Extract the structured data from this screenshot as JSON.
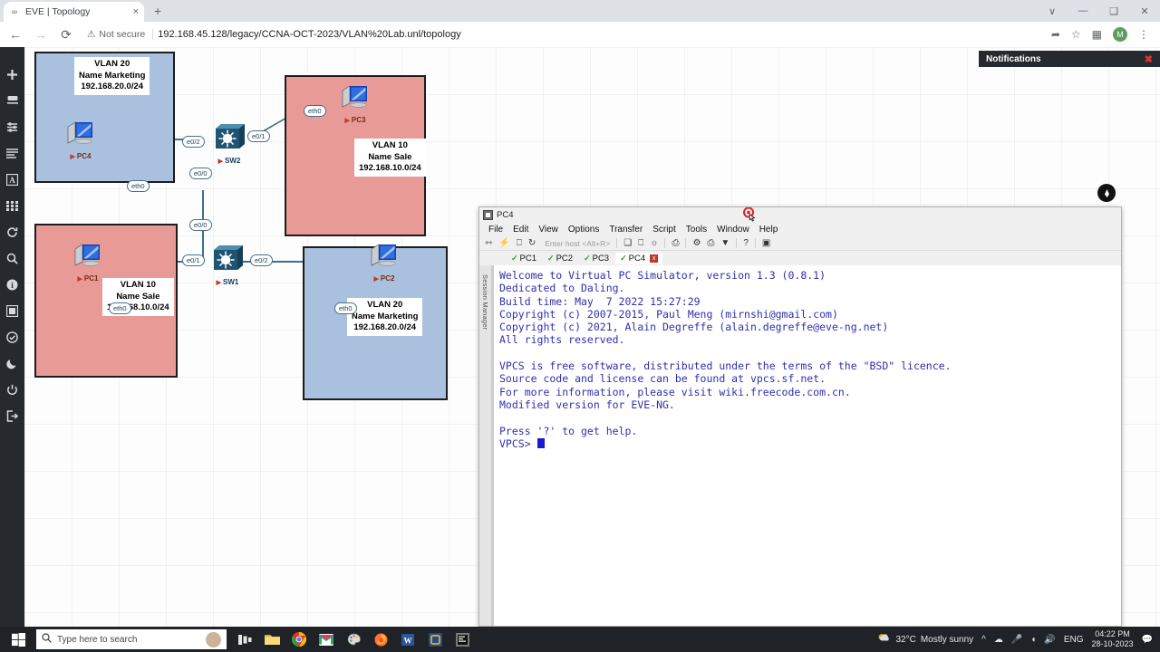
{
  "browser": {
    "tab": {
      "title": "EVE | Topology",
      "favicon": "eve-icon",
      "close": "×"
    },
    "new_tab": "+",
    "window_controls": [
      "∨",
      "—",
      "❑",
      "✕"
    ],
    "nav": {
      "back": "←",
      "forward": "→",
      "reload": "⟳"
    },
    "security_label": "Not secure",
    "url": "192.168.45.128/legacy/CCNA-OCT-2023/VLAN%20Lab.unl/topology",
    "toolbar_right": {
      "share": "share-icon",
      "bookmark": "star-icon",
      "sidepanel": "panel-icon",
      "menu": "⋮"
    },
    "avatar_initial": "M"
  },
  "notifications": {
    "title": "Notifications",
    "close": "✖"
  },
  "eve_sidebar": {
    "items": [
      {
        "name": "add-object-icon",
        "glyph": "+"
      },
      {
        "name": "nodes-icon",
        "glyph": "⌸"
      },
      {
        "name": "network-icon",
        "glyph": "⇅"
      },
      {
        "name": "startup-config-icon",
        "glyph": "≡"
      },
      {
        "name": "text-object-icon",
        "glyph": "A"
      },
      {
        "name": "grid-icon",
        "glyph": "☰"
      },
      {
        "name": "refresh-icon",
        "glyph": "↻"
      },
      {
        "name": "zoom-icon",
        "glyph": "⌕"
      },
      {
        "name": "info-icon",
        "glyph": "i"
      },
      {
        "name": "screen-icon",
        "glyph": "▣"
      },
      {
        "name": "status-icon",
        "glyph": "✓"
      },
      {
        "name": "night-mode-icon",
        "glyph": "☾"
      },
      {
        "name": "power-icon",
        "glyph": "⏻"
      },
      {
        "name": "logout-icon",
        "glyph": "⇥"
      }
    ]
  },
  "topology": {
    "vlan_boxes": [
      {
        "id": "vlan20-left",
        "color": "blue",
        "lines": [
          "VLAN 20",
          "Name Marketing",
          "192.168.20.0/24"
        ]
      },
      {
        "id": "vlan10-left",
        "color": "red",
        "lines": [
          "VLAN 10",
          "Name Sale",
          "192.168.10.0/24"
        ]
      },
      {
        "id": "vlan10-right",
        "color": "red",
        "lines": [
          "VLAN 10",
          "Name Sale",
          "192.168.10.0/24"
        ]
      },
      {
        "id": "vlan20-right",
        "color": "blue",
        "lines": [
          "VLAN 20",
          "Name Marketing",
          "192.168.20.0/24"
        ]
      }
    ],
    "nodes": [
      {
        "name": "PC4",
        "type": "pc"
      },
      {
        "name": "PC1",
        "type": "pc"
      },
      {
        "name": "PC3",
        "type": "pc"
      },
      {
        "name": "PC2",
        "type": "pc"
      },
      {
        "name": "SW2",
        "type": "switch"
      },
      {
        "name": "SW1",
        "type": "switch"
      }
    ],
    "interfaces": {
      "pc4_eth0": "eth0",
      "sw2_e02": "e0/2",
      "sw2_e01": "e0/1",
      "pc3_eth0": "eth0",
      "sw2_e00": "e0/0",
      "sw1_e00": "e0/0",
      "pc1_eth0": "eth0",
      "sw1_e01": "e0/1",
      "sw1_e02": "e0/2",
      "pc2_eth0": "eth0"
    }
  },
  "pen_toolbar": {
    "handle": "pen-handle-icon",
    "items": [
      {
        "name": "visibility-icon",
        "glyph": "◉",
        "selected": true
      },
      {
        "name": "cursor-icon",
        "glyph": "➤",
        "selected": true
      },
      {
        "name": "pen-off-icon",
        "glyph": "⌀",
        "selected": false
      },
      {
        "name": "highlighter-icon",
        "glyph": "◧",
        "selected": false
      },
      {
        "name": "pencil-icon",
        "glyph": "╱",
        "selected": false
      },
      {
        "name": "eraser-icon",
        "glyph": "▱",
        "selected": false
      },
      {
        "name": "dot-size-icon",
        "glyph": "•",
        "selected": false
      },
      {
        "name": "undo-icon",
        "glyph": "↶",
        "selected": false
      },
      {
        "name": "trash-icon",
        "glyph": "Ὕ1",
        "selected": false
      },
      {
        "name": "whiteboard-icon",
        "glyph": "▤",
        "selected": false
      },
      {
        "name": "screenshot-icon",
        "glyph": "▣",
        "selected": false
      },
      {
        "name": "clipboard-icon",
        "glyph": "▧",
        "selected": false
      }
    ],
    "swatches": [
      "#00b9e4",
      "#fff200",
      "#ec008c",
      "#000000"
    ]
  },
  "securecrt": {
    "title": "PC4",
    "menu": [
      "File",
      "Edit",
      "View",
      "Options",
      "Transfer",
      "Script",
      "Tools",
      "Window",
      "Help"
    ],
    "host_placeholder": "Enter host <Alt+R>",
    "toolbar_icons": [
      "connect-icon",
      "quick-connect-icon",
      "connect-sftp-icon",
      "reconnect-icon",
      "copy-icon",
      "paste-icon",
      "find-icon",
      "print-icon",
      "options-icon",
      "keymap-icon",
      "filter-icon",
      "help-icon",
      "chat-icon"
    ],
    "session_manager_label": "Session Manager",
    "tabs": [
      {
        "label": "PC1",
        "active": false
      },
      {
        "label": "PC2",
        "active": false
      },
      {
        "label": "PC3",
        "active": false
      },
      {
        "label": "PC4",
        "active": true
      }
    ],
    "tab_close": "x",
    "terminal": "Welcome to Virtual PC Simulator, version 1.3 (0.8.1)\nDedicated to Daling.\nBuild time: May  7 2022 15:27:29\nCopyright (c) 2007-2015, Paul Meng (mirnshi@gmail.com)\nCopyright (c) 2021, Alain Degreffe (alain.degreffe@eve-ng.net)\nAll rights reserved.\n\nVPCS is free software, distributed under the terms of the \"BSD\" licence.\nSource code and license can be found at vpcs.sf.net.\nFor more information, please visit wiki.freecode.com.cn.\nModified version for EVE-NG.\n\nPress '?' to get help.\n",
    "prompt": "VPCS> "
  },
  "taskbar": {
    "start": "windows-icon",
    "search_placeholder": "Type here to search",
    "apps": [
      {
        "name": "task-view-icon"
      },
      {
        "name": "file-explorer-icon"
      },
      {
        "name": "chrome-icon"
      },
      {
        "name": "gmail-icon"
      },
      {
        "name": "paint-icon"
      },
      {
        "name": "firefox-icon"
      },
      {
        "name": "word-icon"
      },
      {
        "name": "vmware-icon"
      },
      {
        "name": "securecrt-icon"
      }
    ],
    "weather": {
      "temp": "32°C",
      "condition": "Mostly sunny"
    },
    "tray": [
      "show-hidden-icon",
      "onedrive-icon",
      "mic-icon",
      "wifi-icon",
      "volume-icon"
    ],
    "language": "ENG",
    "time": "04:22 PM",
    "date": "28-10-2023",
    "action_center": "notification-icon"
  }
}
